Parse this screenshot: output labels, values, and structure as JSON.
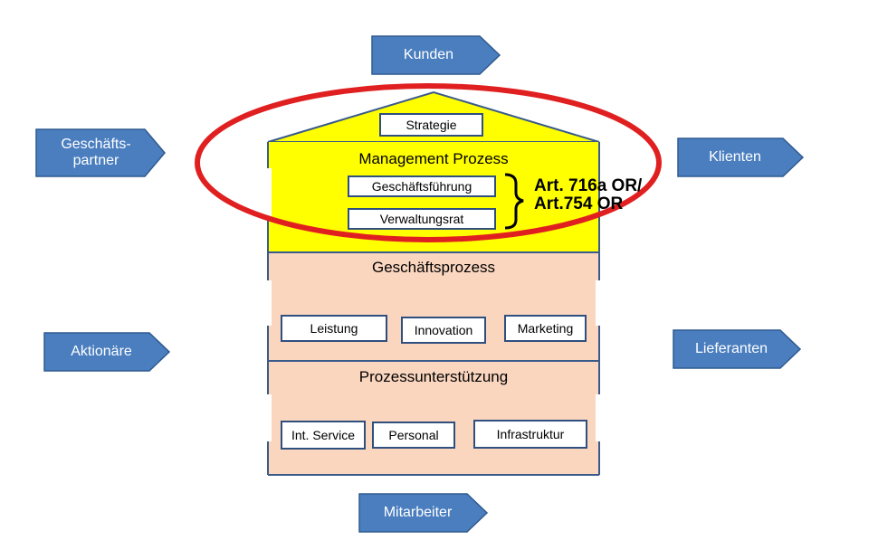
{
  "colors": {
    "arrow_fill": "#4a7ebf",
    "arrow_stroke": "#2f5a8f",
    "management_fill": "#ffff00",
    "process_fill": "#fad6bf",
    "house_outline": "#3a5a8a",
    "highlight_ellipse": "#e02020"
  },
  "arrows": {
    "kunden": "Kunden",
    "geschaeftspartner_line1": "Geschäfts-",
    "geschaeftspartner_line2": "partner",
    "klienten": "Klienten",
    "aktionaere": "Aktionäre",
    "lieferanten": "Lieferanten",
    "mitarbeiter": "Mitarbeiter"
  },
  "house": {
    "roof": {
      "strategie": "Strategie"
    },
    "management": {
      "title": "Management Prozess",
      "items": [
        "Geschäftsführung",
        "Verwaltungsrat"
      ],
      "annotation_line1": "Art. 716a OR/",
      "annotation_line2": "Art.754 OR"
    },
    "business": {
      "title": "Geschäftsprozess",
      "items": [
        "Leistung",
        "Innovation",
        "Marketing"
      ]
    },
    "support": {
      "title": "Prozessunterstützung",
      "items": [
        "Int. Service",
        "Personal",
        "Infrastruktur"
      ]
    }
  }
}
